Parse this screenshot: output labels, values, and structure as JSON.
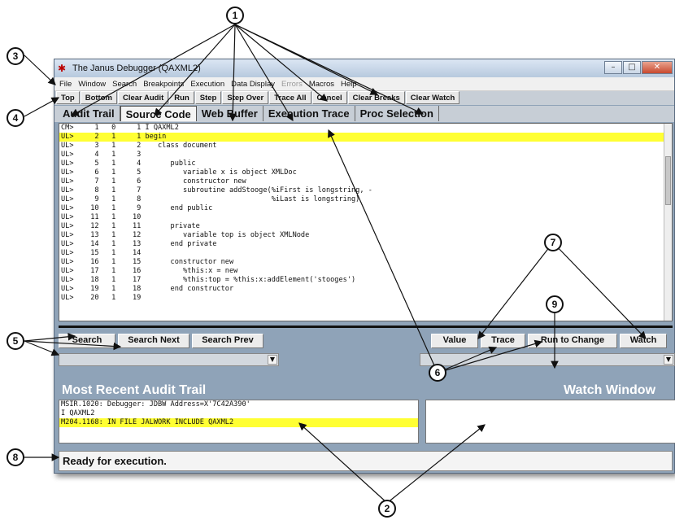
{
  "window": {
    "title": "The Janus Debugger (QAXML2)",
    "app_icon": "janus-bug-icon",
    "controls": [
      "minimize-icon",
      "maximize-icon",
      "close-icon"
    ]
  },
  "menu": [
    "File",
    "Window",
    "Search",
    "Breakpoints",
    "Execution",
    "Data Display",
    "Errors",
    "Macros",
    "Help"
  ],
  "toolbar": [
    "Top",
    "Bottom",
    "Clear Audit",
    "Run",
    "Step",
    "Step Over",
    "Trace All",
    "Cancel",
    "Clear Breaks",
    "Clear Watch"
  ],
  "tabs": [
    "Audit Trail",
    "Source Code",
    "Web Buffer",
    "Execution Trace",
    "Proc Selection"
  ],
  "active_tab": "Source Code",
  "source_lines": [
    "CM>     1   0     1 I QAXML2",
    "UL>     2   1     1 begin",
    "UL>     3   1     2    class document",
    "UL>     4   1     3",
    "UL>     5   1     4       public",
    "UL>     6   1     5          variable x is object XMLDoc",
    "UL>     7   1     6          constructor new",
    "UL>     8   1     7          subroutine addStooge(%iFirst is longstring, -",
    "UL>     9   1     8                               %iLast is longstring)",
    "UL>    10   1     9       end public",
    "UL>    11   1    10",
    "UL>    12   1    11       private",
    "UL>    13   1    12          variable top is object XMLNode",
    "UL>    14   1    13       end private",
    "UL>    15   1    14",
    "UL>    16   1    15       constructor new",
    "UL>    17   1    16          %this:x = new",
    "UL>    18   1    17          %this:top = %this:x:addElement('stooges')",
    "UL>    19   1    18       end constructor",
    "UL>    20   1    19"
  ],
  "search_buttons": [
    "Search",
    "Search Next",
    "Search Prev"
  ],
  "watch_buttons": [
    "Value",
    "Trace",
    "Run to Change",
    "Watch"
  ],
  "audit": {
    "title": "Most Recent Audit Trail",
    "lines": [
      "MSIR.1020: Debugger: JDBW Address=X'7C42A390'",
      "I QAXML2",
      "M204.1168: IN FILE JALWORK INCLUDE QAXML2"
    ]
  },
  "watch": {
    "title": "Watch Window"
  },
  "status": "Ready for execution.",
  "callouts": [
    "1",
    "2",
    "3",
    "4",
    "5",
    "6",
    "7",
    "8",
    "9"
  ],
  "colors": {
    "highlight": "#ffff33",
    "panel": "#8fa3b8",
    "toolbar": "#c7ced6"
  }
}
